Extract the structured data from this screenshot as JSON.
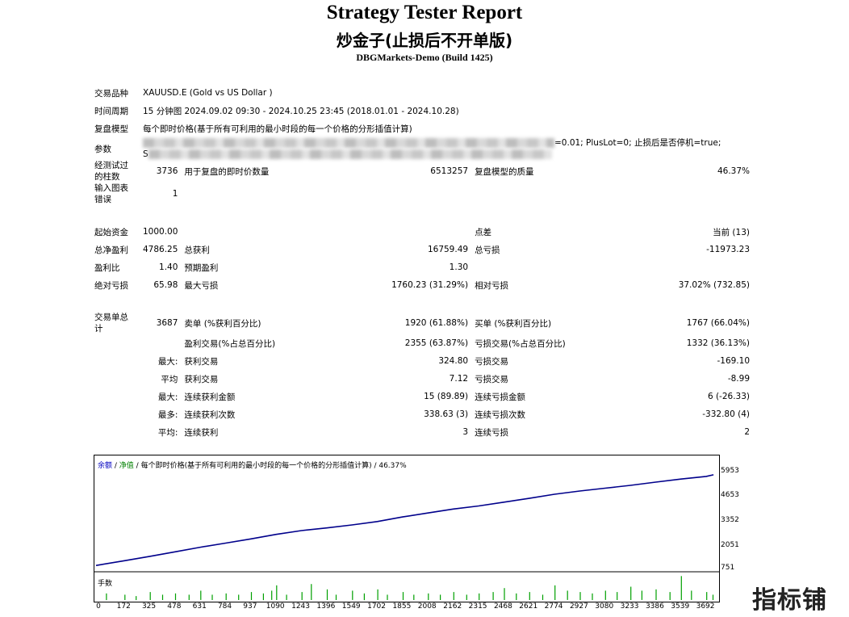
{
  "header": {
    "title": "Strategy Tester Report",
    "subtitle": "炒金子(止损后不开单版)",
    "server": "DBGMarkets-Demo (Build 1425)"
  },
  "settings": {
    "symbol_label": "交易品种",
    "symbol_value": "XAUUSD.E (Gold vs US Dollar )",
    "period_label": "时间周期",
    "period_value": "15 分钟图 2024.09.02 09:30 - 2024.10.25 23:45 (2018.01.01 - 2024.10.28)",
    "model_label": "复盘模型",
    "model_value": "每个即时价格(基于所有可利用的最小时段的每一个价格的分形插值计算)",
    "params_label": "参数",
    "params_visible_line1": "=0.01; PlusLot=0; 止损后是否停机=true;",
    "params_visible_line2": "S"
  },
  "stats": {
    "bars_label": "经测试过的柱数",
    "bars_value": "3736",
    "ticks_label": "用于复盘的即时价数量",
    "ticks_value": "6513257",
    "quality_label": "复盘模型的质量",
    "quality_value": "46.37%",
    "errors_label": "输入图表错误",
    "errors_value": "1",
    "deposit_label": "起始资金",
    "deposit_value": "1000.00",
    "spread_label": "点差",
    "spread_value": "当前 (13)",
    "net_label": "总净盈利",
    "net_value": "4786.25",
    "gross_profit_label": "总获利",
    "gross_profit_value": "16759.49",
    "gross_loss_label": "总亏损",
    "gross_loss_value": "-11973.23",
    "pf_label": "盈利比",
    "pf_value": "1.40",
    "payoff_label": "预期盈利",
    "payoff_value": "1.30",
    "abs_dd_label": "绝对亏损",
    "abs_dd_value": "65.98",
    "max_dd_label": "最大亏损",
    "max_dd_value": "1760.23 (31.29%)",
    "rel_dd_label": "相对亏损",
    "rel_dd_value": "37.02% (732.85)",
    "total_trades_label": "交易单总计",
    "total_trades_value": "3687",
    "short_label": "卖单 (%获利百分比)",
    "short_value": "1920 (61.88%)",
    "long_label": "买单 (%获利百分比)",
    "long_value": "1767 (66.04%)",
    "profit_trades_label": "盈利交易(%占总百分比)",
    "profit_trades_value": "2355 (63.87%)",
    "loss_trades_label": "亏损交易(%占总百分比)",
    "loss_trades_value": "1332 (36.13%)",
    "largest_prefix": "最大:",
    "largest_profit_label": "获利交易",
    "largest_profit_value": "324.80",
    "largest_loss_label": "亏损交易",
    "largest_loss_value": "-169.10",
    "average_prefix": "平均",
    "avg_profit_label": "获利交易",
    "avg_profit_value": "7.12",
    "avg_loss_label": "亏损交易",
    "avg_loss_value": "-8.99",
    "max_prefix": "最大:",
    "max_cons_wins_label": "连续获利金额",
    "max_cons_wins_value": "15 (89.89)",
    "max_cons_losses_label": "连续亏损金额",
    "max_cons_losses_value": "6 (-26.33)",
    "maximal_prefix": "最多:",
    "maximal_cons_profit_label": "连续获利次数",
    "maximal_cons_profit_value": "338.63 (3)",
    "maximal_cons_loss_label": "连续亏损次数",
    "maximal_cons_loss_value": "-332.80 (4)",
    "avg2_prefix": "平均:",
    "avg_cons_wins_label": "连续获利",
    "avg_cons_wins_value": "3",
    "avg_cons_losses_label": "连续亏损",
    "avg_cons_losses_value": "2"
  },
  "chart_data": {
    "type": "line",
    "header_balance": "余额",
    "header_equity": "净值",
    "header_rest": "每个即时价格(基于所有可利用的最小时段的每一个价格的分形插值计算) / 46.37%",
    "volume_label": "手数",
    "yticks": [
      "5953",
      "4653",
      "3352",
      "2051",
      "751"
    ],
    "xticks": [
      "0",
      "172",
      "325",
      "478",
      "631",
      "784",
      "937",
      "1090",
      "1243",
      "1396",
      "1549",
      "1702",
      "1855",
      "2008",
      "2162",
      "2315",
      "2468",
      "2621",
      "2774",
      "2927",
      "3080",
      "3233",
      "3386",
      "3539",
      "3692"
    ],
    "xlim": [
      0,
      3760
    ],
    "ylim": [
      751,
      5953
    ],
    "series": [
      {
        "name": "余额",
        "color": "#00008b",
        "x": [
          0,
          172,
          325,
          478,
          631,
          784,
          937,
          1090,
          1243,
          1396,
          1549,
          1702,
          1855,
          2008,
          2162,
          2315,
          2468,
          2621,
          2774,
          2927,
          3080,
          3233,
          3386,
          3539,
          3692,
          3736
        ],
        "values": [
          1000,
          1250,
          1480,
          1720,
          1960,
          2180,
          2400,
          2640,
          2840,
          2980,
          3140,
          3320,
          3560,
          3770,
          3980,
          4140,
          4340,
          4540,
          4760,
          4930,
          5080,
          5230,
          5400,
          5560,
          5700,
          5786
        ]
      }
    ],
    "volume_bars": [
      [
        60,
        0.25
      ],
      [
        172,
        0.2
      ],
      [
        240,
        0.15
      ],
      [
        325,
        0.3
      ],
      [
        400,
        0.2
      ],
      [
        478,
        0.25
      ],
      [
        560,
        0.2
      ],
      [
        631,
        0.35
      ],
      [
        700,
        0.2
      ],
      [
        784,
        0.25
      ],
      [
        860,
        0.2
      ],
      [
        937,
        0.3
      ],
      [
        1010,
        0.25
      ],
      [
        1060,
        0.35
      ],
      [
        1090,
        0.55
      ],
      [
        1150,
        0.2
      ],
      [
        1243,
        0.3
      ],
      [
        1300,
        0.6
      ],
      [
        1396,
        0.4
      ],
      [
        1450,
        0.2
      ],
      [
        1549,
        0.35
      ],
      [
        1620,
        0.25
      ],
      [
        1702,
        0.4
      ],
      [
        1760,
        0.2
      ],
      [
        1855,
        0.3
      ],
      [
        1920,
        0.2
      ],
      [
        2008,
        0.25
      ],
      [
        2080,
        0.2
      ],
      [
        2162,
        0.3
      ],
      [
        2240,
        0.2
      ],
      [
        2315,
        0.25
      ],
      [
        2400,
        0.3
      ],
      [
        2468,
        0.45
      ],
      [
        2540,
        0.25
      ],
      [
        2621,
        0.3
      ],
      [
        2700,
        0.2
      ],
      [
        2774,
        0.55
      ],
      [
        2850,
        0.35
      ],
      [
        2927,
        0.3
      ],
      [
        3000,
        0.25
      ],
      [
        3080,
        0.35
      ],
      [
        3150,
        0.3
      ],
      [
        3233,
        0.5
      ],
      [
        3300,
        0.35
      ],
      [
        3386,
        0.4
      ],
      [
        3470,
        0.3
      ],
      [
        3539,
        0.9
      ],
      [
        3600,
        0.35
      ],
      [
        3692,
        0.3
      ],
      [
        3730,
        0.2
      ]
    ]
  },
  "watermark": "指标铺"
}
